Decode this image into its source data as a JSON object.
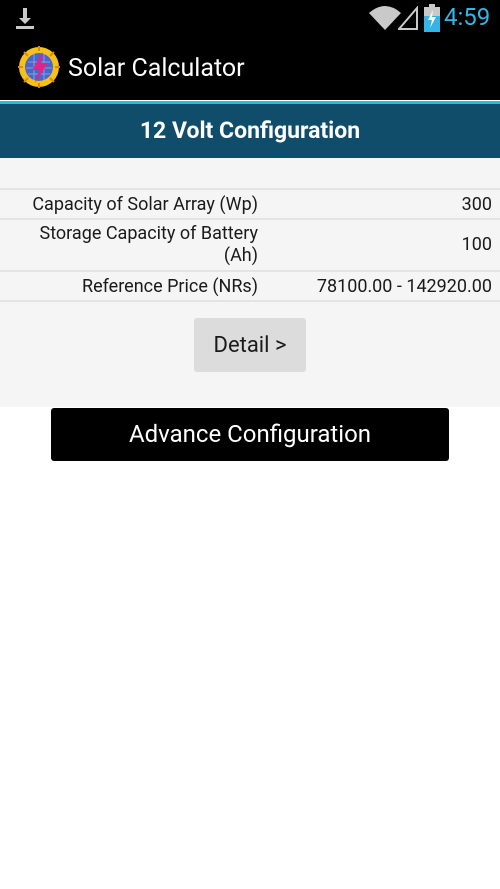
{
  "status_bar": {
    "time": "4:59",
    "icons": [
      "download-icon",
      "wifi-icon",
      "signal-icon",
      "battery-charging-icon"
    ]
  },
  "app": {
    "title": "Solar Calculator",
    "logo": "solar-logo-icon"
  },
  "config": {
    "header": "12 Volt Configuration",
    "rows": [
      {
        "label": "Capacity of Solar Array (Wp)",
        "value": "300"
      },
      {
        "label_line1": "Storage Capacity of Battery",
        "label_line2": "(Ah)",
        "value": "100"
      },
      {
        "label": "Reference Price (NRs)",
        "value": "78100.00 - 142920.00"
      }
    ],
    "detail_button": "Detail >"
  },
  "advance_button": "Advance Configuration",
  "colors": {
    "accent": "#33b5e5",
    "header_bg": "#0f4d6a",
    "panel_bg": "#f5f5f5",
    "button_gray": "#dcdcdc"
  }
}
